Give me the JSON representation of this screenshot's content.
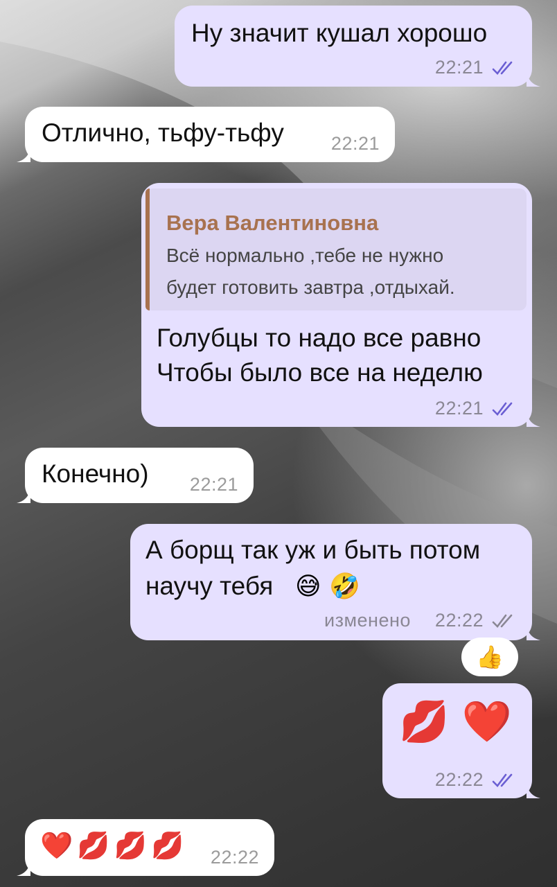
{
  "messages": [
    {
      "text": "Ну значит кушал хорошо",
      "time": "22:21"
    },
    {
      "text": "Отлично, тьфу-тьфу",
      "time": "22:21"
    },
    {
      "reply_name": "Вера Валентиновна",
      "reply_line1": "Всё нормально ,тебе не нужно",
      "reply_line2": "будет готовить завтра ,отдыхай.",
      "line1": "Голубцы то надо все равно",
      "line2": "Чтобы было все на неделю",
      "time": "22:21"
    },
    {
      "text": "Конечно)",
      "time": "22:21"
    },
    {
      "line1": "А борщ так уж и быть потом",
      "line2": "научу тебя",
      "emoji": "😅 🤣",
      "edited": "изменено",
      "time": "22:22",
      "reaction": "👍"
    },
    {
      "emoji": "💋 ❤️",
      "time": "22:22"
    },
    {
      "emoji": "❤️💋💋💋",
      "time": "22:22"
    }
  ],
  "colors": {
    "outgoing_bubble": "#e6e0ff",
    "incoming_bubble": "#ffffff",
    "read_ticks": "#6b5fd3",
    "reply_accent": "#a8724f"
  }
}
